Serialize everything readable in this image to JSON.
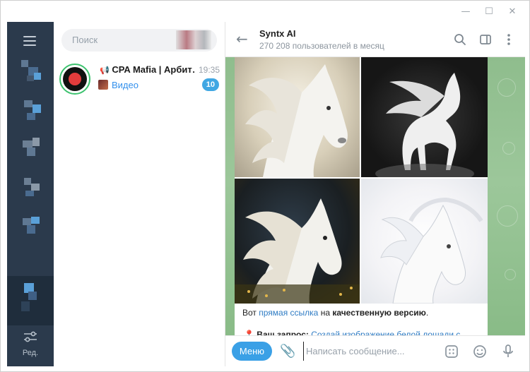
{
  "window": {
    "controls": {
      "minimize": "—",
      "maximize": "☐",
      "close": "✕"
    }
  },
  "rail": {
    "edit_label": "Ред."
  },
  "search": {
    "placeholder": "Поиск"
  },
  "chats": [
    {
      "name": "CPA Mafia | Арбит…",
      "time": "19:35",
      "preview": "Видео",
      "unread": "10"
    }
  ],
  "header": {
    "title": "Syntx AI",
    "subtitle": "270 208 пользователей в месяц"
  },
  "message": {
    "caption_prefix": "Вот ",
    "caption_link": "прямая ссылка",
    "caption_mid": " на ",
    "caption_bold": "качественную версию",
    "caption_suffix": ".",
    "request_label": "Ваш запрос:",
    "request_text": " Создай изображение белой лошади с"
  },
  "composer": {
    "menu_label": "Меню",
    "placeholder": "Написать сообщение..."
  },
  "colors": {
    "accent": "#3aa0e6",
    "rail": "#2b3a4c",
    "chat_bg": "#8fbd8d",
    "badge": "#40a7e3"
  }
}
